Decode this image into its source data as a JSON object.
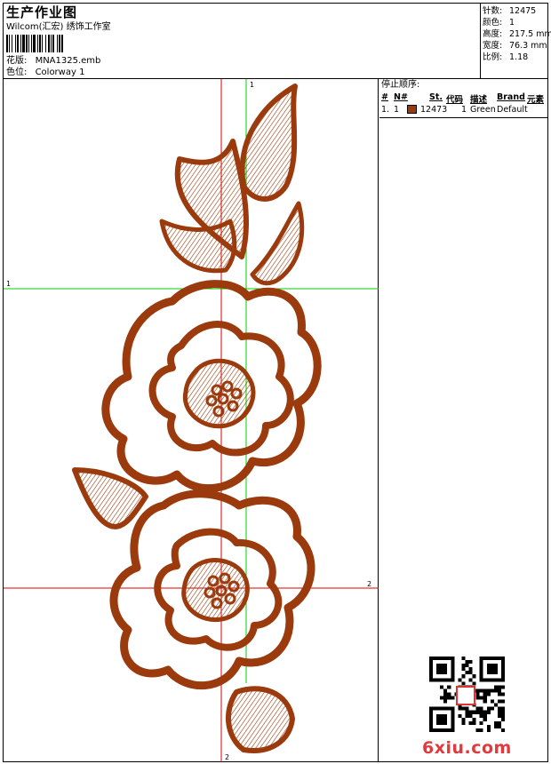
{
  "header": {
    "title": "生产作业图",
    "subtitle": "Wilcom(汇宏) 绣饰工作室",
    "design_label": "花版:",
    "design_value": "MNA1325.emb",
    "colorway_label": "色位:",
    "colorway_value": "Colorway 1"
  },
  "stats": [
    {
      "label": "针数:",
      "value": "12475"
    },
    {
      "label": "颜色:",
      "value": "1"
    },
    {
      "label": "高度:",
      "value": "217.5 mm"
    },
    {
      "label": "宽度:",
      "value": "76.3 mm"
    },
    {
      "label": "比例:",
      "value": "1.18"
    }
  ],
  "stop_sequence": {
    "title": "停止顺序:",
    "columns": [
      "#",
      "N#",
      "St.",
      "代码",
      "描述",
      "Brand",
      "元素"
    ],
    "rows": [
      {
        "index": "1.",
        "needle": "1",
        "color": "#9b3a0c",
        "stitches": "12473",
        "code": "1",
        "description": "Green",
        "brand": "Default",
        "element": ""
      }
    ]
  },
  "guides": {
    "h1_label": "1",
    "h2_label": "2",
    "v1_label": "1",
    "v2_label": "2"
  },
  "watermark": {
    "site": "6xiu.com"
  },
  "design_color": "#9b3a0c"
}
